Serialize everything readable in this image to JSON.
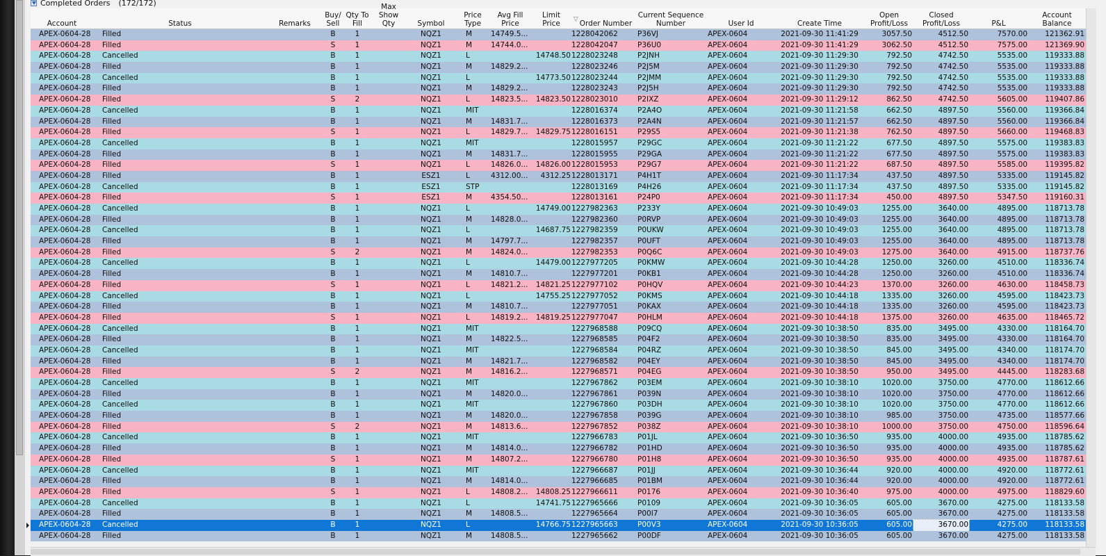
{
  "window": {
    "title": "Completed Orders",
    "count": "(172/172)"
  },
  "colors": {
    "buy_row": "#aec2dc",
    "sell_row": "#f8b3c4",
    "cancel_row": "#a8dbe3",
    "selected_row": "#1177d6"
  },
  "columns": [
    {
      "label": "Account"
    },
    {
      "label": "Status"
    },
    {
      "label": "Remarks"
    },
    {
      "label": "Buy/\nSell"
    },
    {
      "label": "Qty To\nFill"
    },
    {
      "label": "Max\nShow Qty"
    },
    {
      "label": "Symbol"
    },
    {
      "label": "Price\nType"
    },
    {
      "label": "Avg Fill\nPrice"
    },
    {
      "label": "Limit\nPrice"
    },
    {
      "label": "Order Number"
    },
    {
      "label": "Current Sequence\nNumber"
    },
    {
      "label": "User Id"
    },
    {
      "label": "Create Time"
    },
    {
      "label": "Open\nProfit/Loss"
    },
    {
      "label": "Closed\nProfit/Loss"
    },
    {
      "label": "P&L"
    },
    {
      "label": "Account\nBalance"
    }
  ],
  "rows": [
    [
      "APEX-0604-28",
      "Filled",
      "",
      "B",
      "1",
      "",
      "NQZ1",
      "M",
      "14749.5...",
      "",
      "1228042062",
      "P36VJ",
      "APEX-0604",
      "2021-09-30 11:41:29",
      "3057.50",
      "4512.50",
      "7570.00",
      "121362.91"
    ],
    [
      "APEX-0604-28",
      "Filled",
      "",
      "S",
      "1",
      "",
      "NQZ1",
      "M",
      "14744.0...",
      "",
      "1228042047",
      "P36U0",
      "APEX-0604",
      "2021-09-30 11:41:29",
      "3062.50",
      "4512.50",
      "7575.00",
      "121369.90"
    ],
    [
      "APEX-0604-28",
      "Cancelled",
      "",
      "B",
      "1",
      "",
      "NQZ1",
      "L",
      "",
      "14748.50",
      "1228023248",
      "P2JNH",
      "APEX-0604",
      "2021-09-30 11:29:30",
      "792.50",
      "4742.50",
      "5535.00",
      "119333.88"
    ],
    [
      "APEX-0604-28",
      "Filled",
      "",
      "B",
      "1",
      "",
      "NQZ1",
      "M",
      "14829.2...",
      "",
      "1228023246",
      "P2J5M",
      "APEX-0604",
      "2021-09-30 11:29:30",
      "792.50",
      "4742.50",
      "5535.00",
      "119333.88"
    ],
    [
      "APEX-0604-28",
      "Cancelled",
      "",
      "B",
      "1",
      "",
      "NQZ1",
      "L",
      "",
      "14773.50",
      "1228023244",
      "P2JMM",
      "APEX-0604",
      "2021-09-30 11:29:30",
      "792.50",
      "4742.50",
      "5535.00",
      "119333.88"
    ],
    [
      "APEX-0604-28",
      "Filled",
      "",
      "B",
      "1",
      "",
      "NQZ1",
      "M",
      "14829.2...",
      "",
      "1228023243",
      "P2J5H",
      "APEX-0604",
      "2021-09-30 11:29:30",
      "792.50",
      "4742.50",
      "5535.00",
      "119333.88"
    ],
    [
      "APEX-0604-28",
      "Filled",
      "",
      "S",
      "2",
      "",
      "NQZ1",
      "L",
      "14823.5...",
      "14823.50",
      "1228023010",
      "P2IXZ",
      "APEX-0604",
      "2021-09-30 11:29:12",
      "862.50",
      "4742.50",
      "5605.00",
      "119407.86"
    ],
    [
      "APEX-0604-28",
      "Cancelled",
      "",
      "B",
      "1",
      "",
      "NQZ1",
      "MIT",
      "",
      "",
      "1228016374",
      "P2A4O",
      "APEX-0604",
      "2021-09-30 11:21:58",
      "662.50",
      "4897.50",
      "5560.00",
      "119366.84"
    ],
    [
      "APEX-0604-28",
      "Filled",
      "",
      "B",
      "1",
      "",
      "NQZ1",
      "M",
      "14831.7...",
      "",
      "1228016373",
      "P2A4N",
      "APEX-0604",
      "2021-09-30 11:21:57",
      "662.50",
      "4897.50",
      "5560.00",
      "119366.84"
    ],
    [
      "APEX-0604-28",
      "Filled",
      "",
      "S",
      "1",
      "",
      "NQZ1",
      "L",
      "14829.7...",
      "14829.75",
      "1228016151",
      "P29S5",
      "APEX-0604",
      "2021-09-30 11:21:38",
      "762.50",
      "4897.50",
      "5660.00",
      "119468.83"
    ],
    [
      "APEX-0604-28",
      "Cancelled",
      "",
      "B",
      "1",
      "",
      "NQZ1",
      "MIT",
      "",
      "",
      "1228015957",
      "P29GC",
      "APEX-0604",
      "2021-09-30 11:21:22",
      "677.50",
      "4897.50",
      "5575.00",
      "119383.83"
    ],
    [
      "APEX-0604-28",
      "Filled",
      "",
      "B",
      "1",
      "",
      "NQZ1",
      "M",
      "14831.7...",
      "",
      "1228015955",
      "P29GA",
      "APEX-0604",
      "2021-09-30 11:21:22",
      "677.50",
      "4897.50",
      "5575.00",
      "119383.83"
    ],
    [
      "APEX-0604-28",
      "Filled",
      "",
      "S",
      "1",
      "",
      "NQZ1",
      "L",
      "14826.0...",
      "14826.00",
      "1228015953",
      "P29G7",
      "APEX-0604",
      "2021-09-30 11:21:22",
      "687.50",
      "4897.50",
      "5585.00",
      "119395.82"
    ],
    [
      "APEX-0604-28",
      "Filled",
      "",
      "B",
      "1",
      "",
      "ESZ1",
      "L",
      "4312.00...",
      "4312.25",
      "1228013171",
      "P4H1T",
      "APEX-0604",
      "2021-09-30 11:17:34",
      "437.50",
      "4897.50",
      "5335.00",
      "119145.82"
    ],
    [
      "APEX-0604-28",
      "Cancelled",
      "",
      "B",
      "1",
      "",
      "ESZ1",
      "STP",
      "",
      "",
      "1228013169",
      "P4H26",
      "APEX-0604",
      "2021-09-30 11:17:34",
      "437.50",
      "4897.50",
      "5335.00",
      "119145.82"
    ],
    [
      "APEX-0604-28",
      "Filled",
      "",
      "S",
      "1",
      "",
      "ESZ1",
      "M",
      "4354.50...",
      "",
      "1228013161",
      "P24P0",
      "APEX-0604",
      "2021-09-30 11:17:34",
      "450.00",
      "4897.50",
      "5347.50",
      "119160.31"
    ],
    [
      "APEX-0604-28",
      "Cancelled",
      "",
      "B",
      "1",
      "",
      "NQZ1",
      "L",
      "",
      "14749.00",
      "1227982363",
      "P233Y",
      "APEX-0604",
      "2021-09-30 10:49:03",
      "1255.00",
      "3640.00",
      "4895.00",
      "118713.78"
    ],
    [
      "APEX-0604-28",
      "Filled",
      "",
      "B",
      "1",
      "",
      "NQZ1",
      "M",
      "14828.0...",
      "",
      "1227982360",
      "P0RVP",
      "APEX-0604",
      "2021-09-30 10:49:03",
      "1255.00",
      "3640.00",
      "4895.00",
      "118713.78"
    ],
    [
      "APEX-0604-28",
      "Cancelled",
      "",
      "B",
      "1",
      "",
      "NQZ1",
      "L",
      "",
      "14687.75",
      "1227982359",
      "P0UKW",
      "APEX-0604",
      "2021-09-30 10:49:03",
      "1255.00",
      "3640.00",
      "4895.00",
      "118713.78"
    ],
    [
      "APEX-0604-28",
      "Filled",
      "",
      "B",
      "1",
      "",
      "NQZ1",
      "M",
      "14797.7...",
      "",
      "1227982357",
      "P0UFT",
      "APEX-0604",
      "2021-09-30 10:49:03",
      "1255.00",
      "3640.00",
      "4895.00",
      "118713.78"
    ],
    [
      "APEX-0604-28",
      "Filled",
      "",
      "S",
      "2",
      "",
      "NQZ1",
      "M",
      "14824.0...",
      "",
      "1227982353",
      "P0Q6C",
      "APEX-0604",
      "2021-09-30 10:49:03",
      "1275.00",
      "3640.00",
      "4915.00",
      "118737.76"
    ],
    [
      "APEX-0604-28",
      "Cancelled",
      "",
      "B",
      "1",
      "",
      "NQZ1",
      "L",
      "",
      "14479.00",
      "1227977205",
      "P0KMW",
      "APEX-0604",
      "2021-09-30 10:44:28",
      "1250.00",
      "3260.00",
      "4510.00",
      "118336.74"
    ],
    [
      "APEX-0604-28",
      "Filled",
      "",
      "B",
      "1",
      "",
      "NQZ1",
      "M",
      "14810.7...",
      "",
      "1227977201",
      "P0KB1",
      "APEX-0604",
      "2021-09-30 10:44:28",
      "1250.00",
      "3260.00",
      "4510.00",
      "118336.74"
    ],
    [
      "APEX-0604-28",
      "Filled",
      "",
      "S",
      "1",
      "",
      "NQZ1",
      "L",
      "14821.2...",
      "14821.25",
      "1227977102",
      "P0HQV",
      "APEX-0604",
      "2021-09-30 10:44:23",
      "1370.00",
      "3260.00",
      "4630.00",
      "118458.73"
    ],
    [
      "APEX-0604-28",
      "Cancelled",
      "",
      "B",
      "1",
      "",
      "NQZ1",
      "L",
      "",
      "14755.25",
      "1227977052",
      "P0KMS",
      "APEX-0604",
      "2021-09-30 10:44:18",
      "1335.00",
      "3260.00",
      "4595.00",
      "118423.73"
    ],
    [
      "APEX-0604-28",
      "Filled",
      "",
      "B",
      "1",
      "",
      "NQZ1",
      "M",
      "14810.7...",
      "",
      "1227977051",
      "P0KAX",
      "APEX-0604",
      "2021-09-30 10:44:18",
      "1335.00",
      "3260.00",
      "4595.00",
      "118423.73"
    ],
    [
      "APEX-0604-28",
      "Filled",
      "",
      "S",
      "1",
      "",
      "NQZ1",
      "L",
      "14819.2...",
      "14819.25",
      "1227977047",
      "P0HLM",
      "APEX-0604",
      "2021-09-30 10:44:18",
      "1375.00",
      "3260.00",
      "4635.00",
      "118465.72"
    ],
    [
      "APEX-0604-28",
      "Cancelled",
      "",
      "B",
      "1",
      "",
      "NQZ1",
      "MIT",
      "",
      "",
      "1227968588",
      "P09CQ",
      "APEX-0604",
      "2021-09-30 10:38:50",
      "835.00",
      "3495.00",
      "4330.00",
      "118164.70"
    ],
    [
      "APEX-0604-28",
      "Filled",
      "",
      "B",
      "1",
      "",
      "NQZ1",
      "M",
      "14822.5...",
      "",
      "1227968585",
      "P04F2",
      "APEX-0604",
      "2021-09-30 10:38:50",
      "835.00",
      "3495.00",
      "4330.00",
      "118164.70"
    ],
    [
      "APEX-0604-28",
      "Cancelled",
      "",
      "B",
      "1",
      "",
      "NQZ1",
      "MIT",
      "",
      "",
      "1227968584",
      "P04RZ",
      "APEX-0604",
      "2021-09-30 10:38:50",
      "845.00",
      "3495.00",
      "4340.00",
      "118174.70"
    ],
    [
      "APEX-0604-28",
      "Filled",
      "",
      "B",
      "1",
      "",
      "NQZ1",
      "M",
      "14821.7...",
      "",
      "1227968582",
      "P04EY",
      "APEX-0604",
      "2021-09-30 10:38:50",
      "845.00",
      "3495.00",
      "4340.00",
      "118174.70"
    ],
    [
      "APEX-0604-28",
      "Filled",
      "",
      "S",
      "2",
      "",
      "NQZ1",
      "M",
      "14816.2...",
      "",
      "1227968571",
      "P04EG",
      "APEX-0604",
      "2021-09-30 10:38:50",
      "950.00",
      "3495.00",
      "4445.00",
      "118283.68"
    ],
    [
      "APEX-0604-28",
      "Cancelled",
      "",
      "B",
      "1",
      "",
      "NQZ1",
      "MIT",
      "",
      "",
      "1227967862",
      "P03EM",
      "APEX-0604",
      "2021-09-30 10:38:10",
      "1020.00",
      "3750.00",
      "4770.00",
      "118612.66"
    ],
    [
      "APEX-0604-28",
      "Filled",
      "",
      "B",
      "1",
      "",
      "NQZ1",
      "M",
      "14820.0...",
      "",
      "1227967861",
      "P039N",
      "APEX-0604",
      "2021-09-30 10:38:10",
      "1020.00",
      "3750.00",
      "4770.00",
      "118612.66"
    ],
    [
      "APEX-0604-28",
      "Cancelled",
      "",
      "B",
      "1",
      "",
      "NQZ1",
      "MIT",
      "",
      "",
      "1227967860",
      "P03DH",
      "APEX-0604",
      "2021-09-30 10:38:10",
      "1020.00",
      "3750.00",
      "4770.00",
      "118612.66"
    ],
    [
      "APEX-0604-28",
      "Filled",
      "",
      "B",
      "1",
      "",
      "NQZ1",
      "M",
      "14820.0...",
      "",
      "1227967858",
      "P039G",
      "APEX-0604",
      "2021-09-30 10:38:10",
      "985.00",
      "3750.00",
      "4735.00",
      "118577.66"
    ],
    [
      "APEX-0604-28",
      "Filled",
      "",
      "S",
      "2",
      "",
      "NQZ1",
      "M",
      "14813.6...",
      "",
      "1227967852",
      "P038Z",
      "APEX-0604",
      "2021-09-30 10:38:10",
      "1000.00",
      "3750.00",
      "4750.00",
      "118596.64"
    ],
    [
      "APEX-0604-28",
      "Cancelled",
      "",
      "B",
      "1",
      "",
      "NQZ1",
      "MIT",
      "",
      "",
      "1227966783",
      "P01JL",
      "APEX-0604",
      "2021-09-30 10:36:50",
      "935.00",
      "4000.00",
      "4935.00",
      "118785.62"
    ],
    [
      "APEX-0604-28",
      "Filled",
      "",
      "B",
      "1",
      "",
      "NQZ1",
      "M",
      "14814.0...",
      "",
      "1227966782",
      "P01HD",
      "APEX-0604",
      "2021-09-30 10:36:50",
      "935.00",
      "4000.00",
      "4935.00",
      "118785.62"
    ],
    [
      "APEX-0604-28",
      "Filled",
      "",
      "S",
      "1",
      "",
      "NQZ1",
      "M",
      "14807.2...",
      "",
      "1227966780",
      "P01H8",
      "APEX-0604",
      "2021-09-30 10:36:50",
      "935.00",
      "4000.00",
      "4935.00",
      "118787.61"
    ],
    [
      "APEX-0604-28",
      "Cancelled",
      "",
      "B",
      "1",
      "",
      "NQZ1",
      "MIT",
      "",
      "",
      "1227966687",
      "P01JJ",
      "APEX-0604",
      "2021-09-30 10:36:44",
      "920.00",
      "4000.00",
      "4920.00",
      "118772.61"
    ],
    [
      "APEX-0604-28",
      "Filled",
      "",
      "B",
      "1",
      "",
      "NQZ1",
      "M",
      "14814.0...",
      "",
      "1227966685",
      "P01BM",
      "APEX-0604",
      "2021-09-30 10:36:44",
      "920.00",
      "4000.00",
      "4920.00",
      "118772.61"
    ],
    [
      "APEX-0604-28",
      "Filled",
      "",
      "S",
      "1",
      "",
      "NQZ1",
      "L",
      "14808.2...",
      "14808.25",
      "1227966611",
      "P0176",
      "APEX-0604",
      "2021-09-30 10:36:40",
      "975.00",
      "4000.00",
      "4975.00",
      "118829.60"
    ],
    [
      "APEX-0604-28",
      "Cancelled",
      "",
      "B",
      "1",
      "",
      "NQZ1",
      "L",
      "",
      "14741.75",
      "1227965666",
      "P0109",
      "APEX-0604",
      "2021-09-30 10:36:05",
      "605.00",
      "3670.00",
      "4275.00",
      "118133.58"
    ],
    [
      "APEX-0604-28",
      "Filled",
      "",
      "B",
      "1",
      "",
      "NQZ1",
      "M",
      "14808.5...",
      "",
      "1227965664",
      "P00I7",
      "APEX-0604",
      "2021-09-30 10:36:05",
      "605.00",
      "3670.00",
      "4275.00",
      "118133.58"
    ],
    [
      "APEX-0604-28",
      "Cancelled",
      "",
      "B",
      "1",
      "",
      "NQZ1",
      "L",
      "",
      "14766.75",
      "1227965663",
      "P00V3",
      "APEX-0604",
      "2021-09-30 10:36:05",
      "605.00",
      "3670.00",
      "4275.00",
      "118133.58"
    ],
    [
      "APEX-0604-28",
      "Filled",
      "",
      "B",
      "1",
      "",
      "NQZ1",
      "M",
      "14808.5...",
      "",
      "1227965662",
      "P00DF",
      "APEX-0604",
      "2021-09-30 10:36:05",
      "605.00",
      "3670.00",
      "4275.00",
      "118133.58"
    ]
  ],
  "selected_row": 45,
  "focused_column": 15
}
